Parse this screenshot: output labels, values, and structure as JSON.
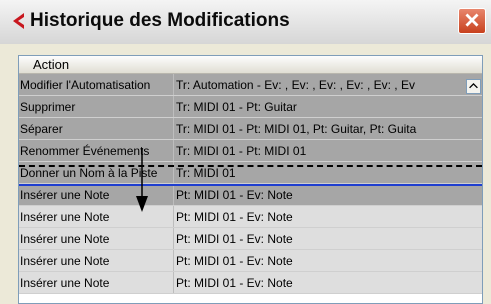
{
  "window": {
    "title": "Historique des Modifications",
    "icon": "cubase-logo-icon",
    "close": "close-icon"
  },
  "table": {
    "header": "Action",
    "rows": [
      {
        "action": "Modifier l'Automatisation",
        "target": "Tr: Automation - Ev: , Ev: , Ev: , Ev: , Ev: , Ev",
        "state": "selected"
      },
      {
        "action": "Supprimer",
        "target": "Tr: MIDI 01 - Pt: Guitar",
        "state": "selected"
      },
      {
        "action": "Séparer",
        "target": "Tr: MIDI 01 - Pt: MIDI 01, Pt: Guitar, Pt: Guita",
        "state": "selected"
      },
      {
        "action": "Renommer Événements",
        "target": "Tr: MIDI 01 - Pt: MIDI 01",
        "state": "selected"
      },
      {
        "action": "Donner un Nom à la Piste",
        "target": "Tr: MIDI 01",
        "state": "selected"
      },
      {
        "action": "Insérer une Note",
        "target": "Pt: MIDI 01 - Ev: Note",
        "state": "selected"
      },
      {
        "action": "Insérer une Note",
        "target": "Pt: MIDI 01 - Ev: Note",
        "state": "normal"
      },
      {
        "action": "Insérer une Note",
        "target": "Pt: MIDI 01 - Ev: Note",
        "state": "normal"
      },
      {
        "action": "Insérer une Note",
        "target": "Pt: MIDI 01 - Ev: Note",
        "state": "normal"
      },
      {
        "action": "Insérer une Note",
        "target": "Pt: MIDI 01 - Ev: Note",
        "state": "normal"
      }
    ]
  },
  "colors": {
    "selected": "#a6a6a6",
    "normal": "#dedede",
    "marker": "#1f3fd0",
    "close": "#c8411e"
  }
}
